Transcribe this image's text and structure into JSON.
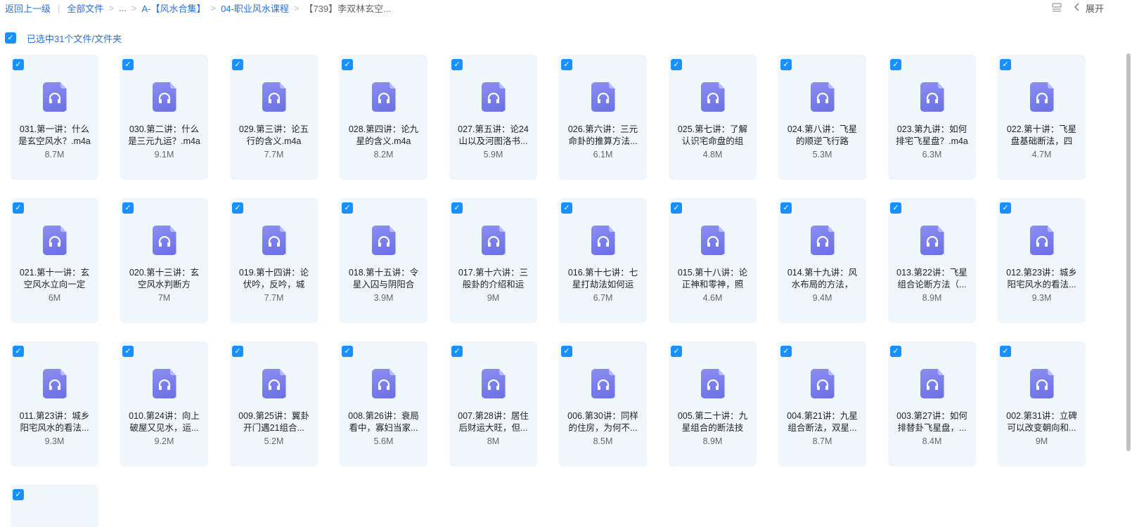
{
  "breadcrumb": {
    "back": "返回上一级",
    "all_files": "全部文件",
    "ellipsis": "...",
    "folder1": "A-【风水合集】",
    "folder2": "04-职业风水课程",
    "current": "【739】李双林玄空..."
  },
  "toolbar": {
    "expand_label": "展开"
  },
  "selection": {
    "label": "已选中31个文件/文件夹"
  },
  "files": [
    {
      "name": "031.第一讲：什么是玄空风水？.m4a",
      "size": "8.7M"
    },
    {
      "name": "030.第二讲：什么是三元九运？.m4a",
      "size": "9.1M"
    },
    {
      "name": "029.第三讲：论五行的含义.m4a",
      "size": "7.7M"
    },
    {
      "name": "028.第四讲：论九星的含义.m4a",
      "size": "8.2M"
    },
    {
      "name": "027.第五讲：论24山以及河图洛书...",
      "size": "5.9M"
    },
    {
      "name": "026.第六讲：三元命卦的推算方法...",
      "size": "6.1M"
    },
    {
      "name": "025.第七讲：了解认识宅命盘的组",
      "size": "4.8M"
    },
    {
      "name": "024.第八讲：飞星的顺逆飞行路",
      "size": "5.3M"
    },
    {
      "name": "023.第九讲：如何排宅飞星盘？.m4a",
      "size": "6.3M"
    },
    {
      "name": "022.第十讲：飞星盘基础断法，四",
      "size": "4.7M"
    },
    {
      "name": "021.第十一讲：玄空风水立向一定",
      "size": "6M"
    },
    {
      "name": "020.第十三讲：玄空风水判断方",
      "size": "7M"
    },
    {
      "name": "019.第十四讲：论伏吟，反吟，城",
      "size": "7.7M"
    },
    {
      "name": "018.第十五讲：令星入囚与阴阳合",
      "size": "3.9M"
    },
    {
      "name": "017.第十六讲：三般卦的介绍和运",
      "size": "9M"
    },
    {
      "name": "016.第十七讲：七星打劫法如何运",
      "size": "6.7M"
    },
    {
      "name": "015.第十八讲：论正神和零神，照",
      "size": "4.6M"
    },
    {
      "name": "014.第十九讲：风水布局的方法，",
      "size": "9.4M"
    },
    {
      "name": "013.第22讲：飞星组合论断方法（...",
      "size": "8.9M"
    },
    {
      "name": "012.第23讲：城乡阳宅风水的看法...",
      "size": "9.3M"
    },
    {
      "name": "011.第23讲：城乡阳宅风水的看法...",
      "size": "9.3M"
    },
    {
      "name": "010.第24讲：向上破屋又见水，运...",
      "size": "9.2M"
    },
    {
      "name": "009.第25讲：翼卦开门遇21组合...",
      "size": "5.2M"
    },
    {
      "name": "008.第26讲：衰局看中，寡妇当家...",
      "size": "5.6M"
    },
    {
      "name": "007.第28讲：居住后财运大旺，但...",
      "size": "8M"
    },
    {
      "name": "006.第30讲：同样的住房，为何不...",
      "size": "8.5M"
    },
    {
      "name": "005.第二十讲：九星组合的断法技",
      "size": "8.9M"
    },
    {
      "name": "004.第21讲：九星组合断法，双星...",
      "size": "8.7M"
    },
    {
      "name": "003.第27讲：如何排替卦飞星盘，...",
      "size": "8.4M"
    },
    {
      "name": "002.第31讲：立碑可以改变朝向和...",
      "size": "9M"
    }
  ],
  "icons": {
    "file_type": "headphones-audio-icon",
    "checkbox": "checkbox-checked-icon",
    "list_view": "list-view-icon",
    "collapse": "chevron-left-icon"
  },
  "colors": {
    "accent": "#1890ff",
    "link": "#2a6fd6",
    "card_bg": "#eff7fd",
    "audio_icon": "#6a6fe5"
  }
}
